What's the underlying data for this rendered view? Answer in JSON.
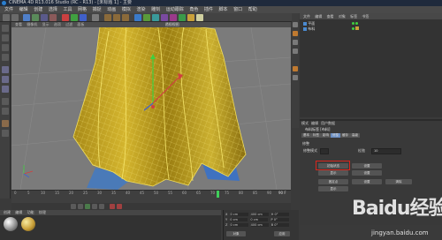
{
  "window": {
    "title": "CINEMA 4D R13.016 Studio (RC - R13) - [未标题 1] - 主要"
  },
  "menubar": {
    "items": [
      "文件",
      "编辑",
      "创建",
      "选择",
      "工具",
      "网格",
      "捕捉",
      "动画",
      "模拟",
      "渲染",
      "雕刻",
      "运动跟踪",
      "角色",
      "插件",
      "脚本",
      "窗口",
      "帮助"
    ]
  },
  "viewport": {
    "menu": [
      "查看",
      "摄像机",
      "显示",
      "选项",
      "过滤",
      "面板"
    ],
    "label": "透视视图"
  },
  "object_manager": {
    "menu": [
      "文件",
      "编辑",
      "查看",
      "对象",
      "标签",
      "书签"
    ],
    "rows": [
      "平面",
      "布料"
    ]
  },
  "attributes": {
    "menu": [
      "模式",
      "编辑",
      "用户数据"
    ],
    "header": "布料标签 [布料]",
    "tabs": [
      "基本",
      "标签",
      "影响",
      "修整",
      "缓存",
      "高级"
    ],
    "section": "修整",
    "fields": [
      {
        "label": "修整模式",
        "value": ""
      },
      {
        "label": "松弛",
        "value": "10"
      }
    ],
    "buttons": [
      "初始状态",
      "设置",
      "显示",
      "设置",
      "固定点",
      "设置",
      "清除",
      "显示"
    ],
    "highlight_label": "初始状态"
  },
  "timeline": {
    "ticks": [
      "0",
      "5",
      "10",
      "15",
      "20",
      "25",
      "30",
      "35",
      "40",
      "45",
      "50",
      "55",
      "60",
      "65",
      "70",
      "75",
      "80",
      "85",
      "90"
    ],
    "end_label": "90 F"
  },
  "materials": {
    "menu": [
      "创建",
      "编辑",
      "功能",
      "纹理"
    ]
  },
  "coordinates": {
    "rows": [
      {
        "axis": "X",
        "pos": "0 cm",
        "size": "400 cm",
        "rot": "H 0°"
      },
      {
        "axis": "Y",
        "pos": "0 cm",
        "size": "0 cm",
        "rot": "P 0°"
      },
      {
        "axis": "Z",
        "pos": "0 cm",
        "size": "400 cm",
        "rot": "B 0°"
      }
    ],
    "mode": "对象",
    "apply": "应用"
  },
  "watermark": {
    "brand": "Baidu经验",
    "url": "jingyan.baidu.com"
  }
}
